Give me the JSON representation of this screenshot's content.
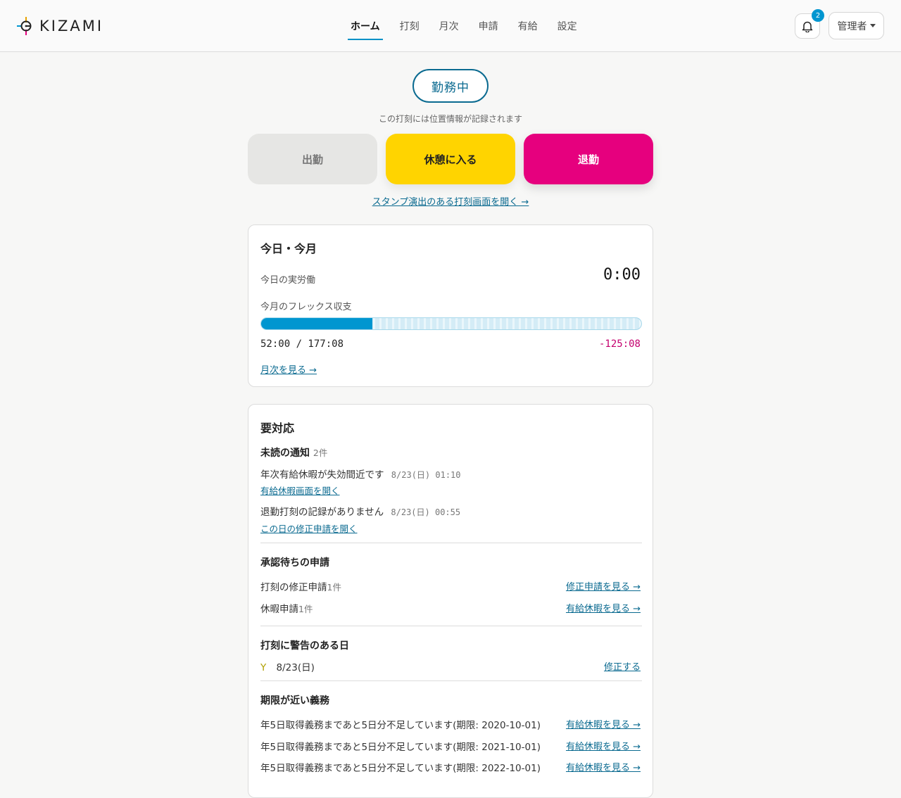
{
  "header": {
    "logo_text": "KIZAMI",
    "nav": [
      {
        "label": "ホーム",
        "active": true
      },
      {
        "label": "打刻",
        "active": false
      },
      {
        "label": "月次",
        "active": false
      },
      {
        "label": "申請",
        "active": false
      },
      {
        "label": "有給",
        "active": false
      },
      {
        "label": "設定",
        "active": false
      }
    ],
    "notification_count": "2",
    "user_menu_label": "管理者"
  },
  "status": {
    "label": "勤務中",
    "location_note": "この打刻には位置情報が記録されます"
  },
  "punch_buttons": {
    "clock_in": "出勤",
    "break": "休憩に入る",
    "clock_out": "退勤"
  },
  "stamp_link": "スタンプ演出のある打刻画面を開く →",
  "today_card": {
    "title": "今日・今月",
    "actual_work_label": "今日の実労働",
    "actual_work_value": "0:00",
    "flex_label": "今月のフレックス収支",
    "flex_progress": 0.293,
    "flex_worked": "52:00 / 177:08",
    "flex_balance": "-125:08",
    "monthly_link": "月次を見る →"
  },
  "action_card": {
    "title": "要対応",
    "unread": {
      "title": "未読の通知",
      "count": "2件",
      "items": [
        {
          "text": "年次有給休暇が失効間近です",
          "time": "8/23(日) 01:10",
          "link": "有給休暇画面を開く"
        },
        {
          "text": "退勤打刻の記録がありません",
          "time": "8/23(日) 00:55",
          "link": "この日の修正申請を開く"
        }
      ]
    },
    "pending": {
      "title": "承認待ちの申請",
      "items": [
        {
          "label": "打刻の修正申請",
          "count": "1件",
          "link": "修正申請を見る →"
        },
        {
          "label": "休暇申請",
          "count": "1件",
          "link": "有給休暇を見る →"
        }
      ]
    },
    "warnings": {
      "title": "打刻に警告のある日",
      "mark": "Y",
      "date": "8/23(日)",
      "link": "修正する"
    },
    "obligations": {
      "title": "期限が近い義務",
      "items": [
        {
          "text": "年5日取得義務まであと5日分不足しています(期限: 2020-10-01)",
          "link": "有給休暇を見る →"
        },
        {
          "text": "年5日取得義務まであと5日分不足しています(期限: 2021-10-01)",
          "link": "有給休暇を見る →"
        },
        {
          "text": "年5日取得義務まであと5日分不足しています(期限: 2022-10-01)",
          "link": "有給休暇を見る →"
        }
      ]
    }
  },
  "colors": {
    "accent": "#0096d0",
    "break_button": "#ffd400",
    "clock_out_button": "#e6007e",
    "negative_balance": "#c4006e"
  }
}
